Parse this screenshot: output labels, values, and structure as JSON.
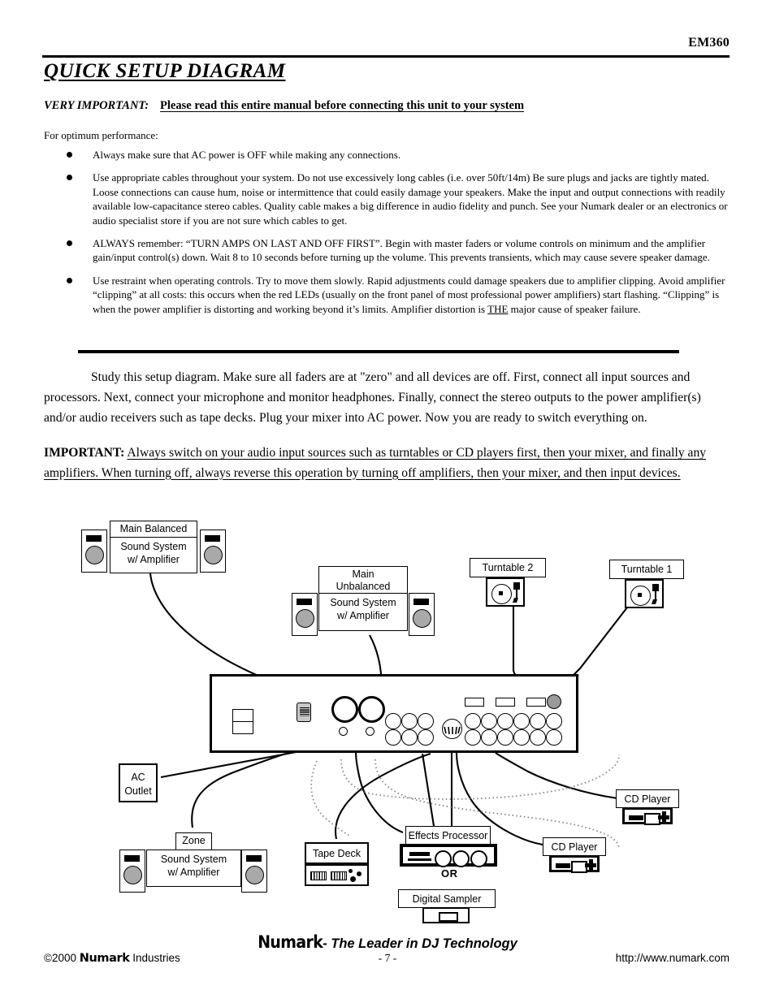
{
  "header": {
    "model": "EM360",
    "title": "QUICK SETUP DIAGRAM"
  },
  "intro": {
    "very_important_label": "VERY IMPORTANT:",
    "very_important_text": "Please read this entire manual before connecting this unit to your system",
    "optimum": "For optimum performance:",
    "bullets": [
      "Always make sure that AC power is OFF while making any connections.",
      "Use appropriate cables throughout your system. Do not use excessively long cables (i.e. over 50ft/14m) Be sure plugs and jacks are tightly mated. Loose connections can cause hum, noise or intermittence that could easily damage your speakers. Make the input and output connections with readily available low-capacitance stereo cables. Quality cable makes a big difference in audio fidelity and punch. See your Numark dealer or an electronics or audio specialist store if you are not sure which cables to get.",
      "ALWAYS remember: “TURN AMPS ON LAST AND OFF FIRST”. Begin with master faders or volume controls on minimum and the amplifier gain/input control(s) down. Wait 8 to 10 seconds before turning up the volume. This prevents transients, which may cause severe speaker damage.",
      "Use restraint when operating controls. Try to move them slowly. Rapid adjustments could damage speakers due to amplifier clipping. Avoid amplifier “clipping” at all costs: this occurs when the red LEDs (usually on the front panel of most professional power amplifiers) start flashing. “Clipping” is when the power amplifier is distorting and working beyond it’s limits. Amplifier distortion is THE major cause of speaker failure."
    ]
  },
  "body": {
    "study_paragraph": "Study this setup diagram. Make sure all faders are at \"zero\" and all devices are off. First, connect all input sources and processors. Next, connect your microphone and monitor headphones. Finally, connect the stereo outputs to the power amplifier(s) and/or audio receivers such as tape decks. Plug your mixer into AC power. Now you are ready to switch everything on.",
    "important_label": "IMPORTANT:",
    "important_text": "Always switch on your audio input sources such as turntables or CD players first, then your mixer, and finally any amplifiers.  When turning off, always reverse this operation by turning off amplifiers, then your mixer, and then input devices."
  },
  "diagram": {
    "main_balanced": {
      "label": "Main Balanced",
      "line1": "Sound System",
      "line2": "w/ Amplifier"
    },
    "main_unbalanced": {
      "label_line1": "Main",
      "label_line2": "Unbalanced",
      "line1": "Sound System",
      "line2": "w/ Amplifier"
    },
    "zone": {
      "label": "Zone",
      "line1": "Sound System",
      "line2": "w/ Amplifier"
    },
    "turntable2": "Turntable 2",
    "turntable1": "Turntable 1",
    "ac_outlet_line1": "AC",
    "ac_outlet_line2": "Outlet",
    "tape_deck": "Tape Deck",
    "effects_processor": "Effects Processor",
    "or": "OR",
    "digital_sampler": "Digital Sampler",
    "cd_player_right": "CD Player",
    "cd_player_center": "CD Player"
  },
  "footer": {
    "brand": "Numark",
    "tagline": "- The Leader in DJ Technology",
    "copyright_prefix": "©2000 ",
    "copyright_brand": "Numark",
    "copyright_suffix": " Industries",
    "page": "- 7 -",
    "url": "http://www.numark.com"
  }
}
